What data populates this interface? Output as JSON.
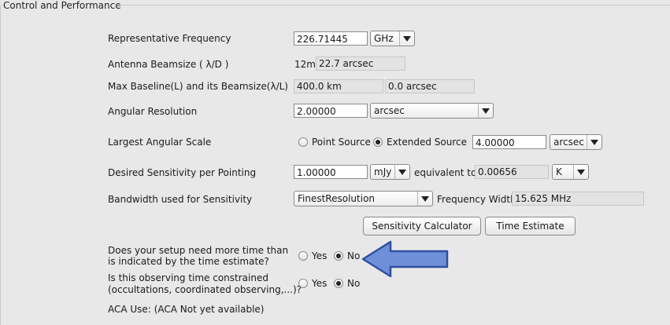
{
  "panel": {
    "title": "Control and Performance"
  },
  "rows": {
    "freq": {
      "label": "Representative Frequency",
      "value": "226.71445",
      "unit": "GHz"
    },
    "beam": {
      "label": "Antenna Beamsize ( λ/D )",
      "prefix": "12m",
      "value": "22.7 arcsec"
    },
    "baseline": {
      "label": "Max Baseline(L) and its Beamsize(λ/L)",
      "km": "400.0 km",
      "arcsec": "0.0 arcsec"
    },
    "angres": {
      "label": "Angular Resolution",
      "value": "2.00000",
      "unit": "arcsec"
    },
    "las": {
      "label": "Largest Angular Scale",
      "opt_point": "Point Source",
      "opt_extended": "Extended Source",
      "value": "4.00000",
      "unit": "arcsec"
    },
    "sens": {
      "label": "Desired Sensitivity per Pointing",
      "value": "1.00000",
      "unit": "mJy",
      "equiv_label": "equivalent to",
      "equiv_value": "0.00656",
      "equiv_unit": "K"
    },
    "bw": {
      "label": "Bandwidth used for Sensitivity",
      "value": "FinestResolution",
      "fw_label": "Frequency Width",
      "fw_value": "15.625 MHz"
    }
  },
  "buttons": {
    "sens_calc": "Sensitivity Calculator",
    "time_est": "Time Estimate"
  },
  "q1": {
    "line1": "Does your setup need more time than",
    "line2": "is indicated by the time estimate?",
    "yes": "Yes",
    "no": "No"
  },
  "q2": {
    "line1": "Is this observing time constrained",
    "line2": "(occultations, coordinated observing,...)?",
    "yes": "Yes",
    "no": "No"
  },
  "aca": {
    "label": "ACA Use:",
    "value": "(ACA Not yet available)"
  },
  "colors": {
    "arrow_fill": "#6f8fd8",
    "arrow_stroke": "#2f4f9f"
  },
  "icons": {
    "dropdown": "chevron-down-icon",
    "pointer": "arrow-left-icon"
  }
}
